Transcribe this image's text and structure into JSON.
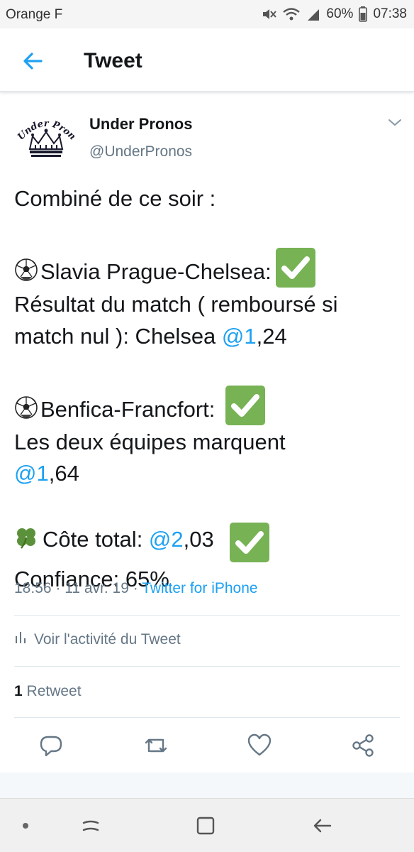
{
  "status_bar": {
    "carrier": "Orange F",
    "battery": "60%",
    "time": "07:38"
  },
  "header": {
    "title": "Tweet"
  },
  "tweet": {
    "author_name": "Under Pronos",
    "author_handle": "@UnderPronos",
    "lines": {
      "l1": "Combiné de ce soir :",
      "l2": "Slavia Prague-Chelsea:",
      "l3": "Résultat du match ( remboursé si",
      "l4_a": "match nul ): Chelsea ",
      "l4_mention": "@1",
      "l4_b": ",24",
      "l5": "Benfica-Francfort:",
      "l6": "Les deux équipes marquent",
      "l7_mention": "@1",
      "l7_b": ",64",
      "l8_a": "Côte total: ",
      "l8_mention": "@2",
      "l8_b": ",03",
      "l9": "Confiance: 65%"
    },
    "timestamp": "18:56 · 11 avr. 19 · ",
    "source": "Twitter for iPhone",
    "activity_label": "Voir l'activité du Tweet",
    "retweet_count": "1",
    "retweet_label": " Retweet"
  },
  "icons": {
    "emoji_ball": "soccer-ball",
    "emoji_clover": "four-leaf-clover",
    "check": "white-check-mark"
  },
  "colors": {
    "accent": "#1da1f2",
    "text": "#14171a",
    "muted": "#657786",
    "check_green": "#77b255"
  }
}
